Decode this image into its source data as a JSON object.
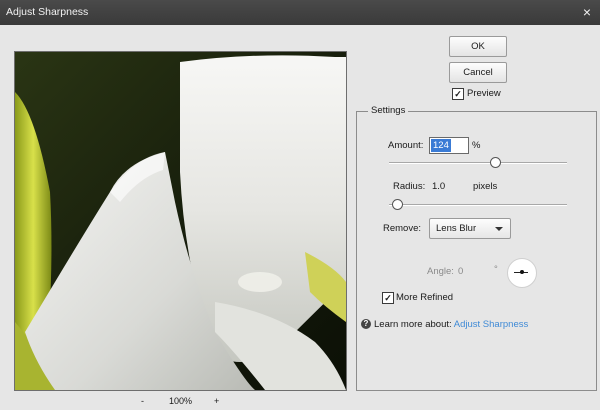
{
  "window": {
    "title": "Adjust Sharpness",
    "close_glyph": "×"
  },
  "buttons": {
    "ok": "OK",
    "cancel": "Cancel"
  },
  "preview_toggle": {
    "label": "Preview",
    "checked": true
  },
  "zoom": {
    "minus": "-",
    "level": "100%",
    "plus": "+"
  },
  "settings": {
    "legend": "Settings",
    "amount": {
      "label": "Amount:",
      "value": "124",
      "unit": "%",
      "slider_fraction": 0.6
    },
    "radius": {
      "label": "Radius:",
      "value": "1.0",
      "unit": "pixels",
      "slider_fraction": 0.05
    },
    "remove": {
      "label": "Remove:",
      "selected": "Lens Blur"
    },
    "angle": {
      "label": "Angle:",
      "value": "0",
      "unit": "°"
    },
    "more_refined": {
      "label": "More Refined",
      "checked": true
    },
    "learn_more": {
      "prefix": "Learn more about:",
      "link": "Adjust Sharpness"
    }
  },
  "icons": [
    "close-icon",
    "checkmark-icon",
    "dropdown-arrow-icon",
    "help-icon",
    "angle-dial-icon"
  ]
}
